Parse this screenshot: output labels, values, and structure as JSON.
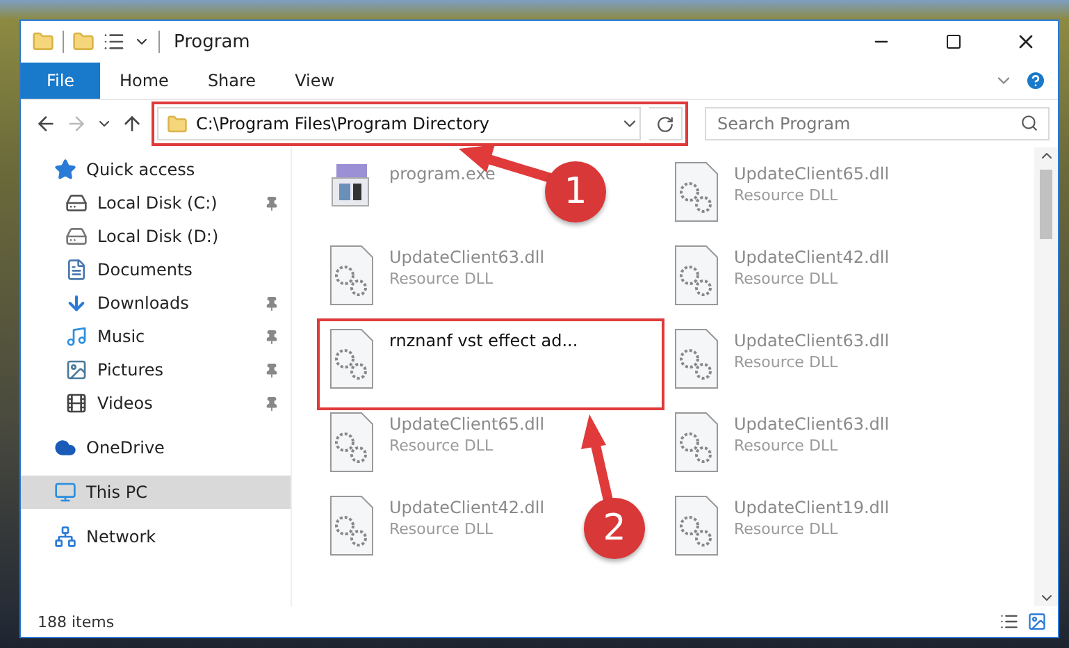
{
  "window": {
    "title": "Program"
  },
  "ribbon": {
    "file_tab": "File",
    "tabs": [
      "Home",
      "Share",
      "View"
    ]
  },
  "address": {
    "path": "C:\\Program Files\\Program Directory"
  },
  "search": {
    "placeholder": "Search Program"
  },
  "navigation": [
    {
      "label": "Quick access",
      "kind": "star",
      "selected": false,
      "children": [
        {
          "label": "Local Disk (C:)",
          "kind": "system-disk",
          "pinned": true,
          "selected": false
        },
        {
          "label": "Local Disk (D:)",
          "kind": "disk",
          "pinned": false,
          "selected": false
        },
        {
          "label": "Documents",
          "kind": "document",
          "pinned": false,
          "selected": false
        },
        {
          "label": "Downloads",
          "kind": "download",
          "pinned": true,
          "selected": false
        },
        {
          "label": "Music",
          "kind": "music",
          "pinned": true,
          "selected": false
        },
        {
          "label": "Pictures",
          "kind": "pictures",
          "pinned": true,
          "selected": false
        },
        {
          "label": "Videos",
          "kind": "videos",
          "pinned": true,
          "selected": false
        }
      ]
    },
    {
      "label": "OneDrive",
      "kind": "cloud",
      "selected": false
    },
    {
      "label": "This PC",
      "kind": "pc",
      "selected": true
    },
    {
      "label": "Network",
      "kind": "network",
      "selected": false
    }
  ],
  "files": [
    {
      "name": "program.exe",
      "kind": "exe",
      "highlighted": false
    },
    {
      "name": "UpdateClient65.dll",
      "type": "Resource DLL",
      "kind": "dll",
      "highlighted": false
    },
    {
      "name": "UpdateClient63.dll",
      "type": "Resource DLL",
      "kind": "dll",
      "highlighted": false
    },
    {
      "name": "UpdateClient42.dll",
      "type": "Resource DLL",
      "kind": "dll",
      "highlighted": false
    },
    {
      "name": "rnznanf vst effect ad...",
      "kind": "dll",
      "highlighted": true
    },
    {
      "name": "UpdateClient63.dll",
      "type": "Resource DLL",
      "kind": "dll",
      "highlighted": false
    },
    {
      "name": "UpdateClient65.dll",
      "type": "Resource DLL",
      "kind": "dll",
      "highlighted": false
    },
    {
      "name": "UpdateClient63.dll",
      "type": "Resource DLL",
      "kind": "dll",
      "highlighted": false
    },
    {
      "name": "UpdateClient42.dll",
      "type": "Resource DLL",
      "kind": "dll",
      "highlighted": false
    },
    {
      "name": "UpdateClient19.dll",
      "type": "Resource DLL",
      "kind": "dll",
      "highlighted": false
    }
  ],
  "status_bar": {
    "item_count": "188 items"
  },
  "annotations": [
    {
      "label": "1"
    },
    {
      "label": "2"
    }
  ]
}
